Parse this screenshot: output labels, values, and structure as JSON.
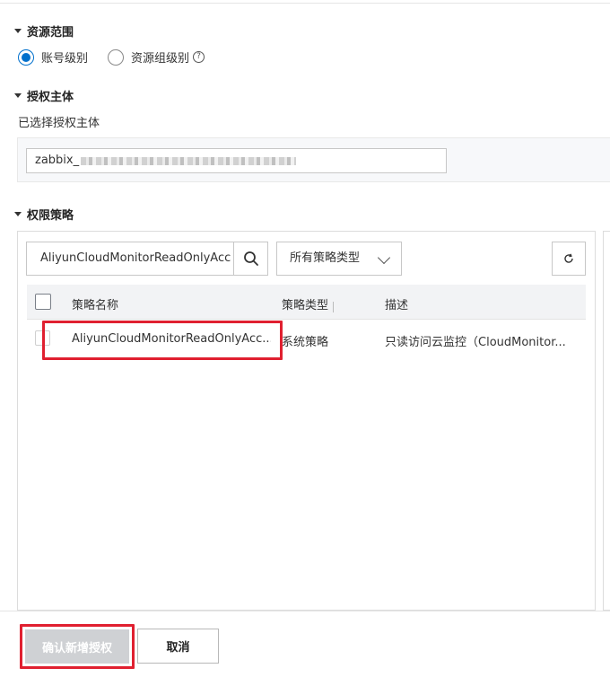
{
  "resource_scope": {
    "title": "资源范围",
    "options": [
      {
        "label": "账号级别",
        "checked": true
      },
      {
        "label": "资源组级别",
        "checked": false
      }
    ],
    "help_icon": "question-circle-icon"
  },
  "principal": {
    "title": "授权主体",
    "selected_label": "已选择授权主体",
    "value": "zabbix_"
  },
  "policy": {
    "title": "权限策略",
    "search_value": "AliyunCloudMonitorReadOnlyAcc",
    "type_select": "所有策略类型",
    "columns": [
      "策略名称",
      "策略类型",
      "描述"
    ],
    "rows": [
      {
        "name": "AliyunCloudMonitorReadOnlyAcc...",
        "type": "系统策略",
        "description": "只读访问云监控（CloudMonitor..."
      }
    ]
  },
  "footer": {
    "confirm_label": "确认新增授权",
    "cancel_label": "取消"
  },
  "colors": {
    "accent": "#0070cc",
    "highlight": "#e02030",
    "disabled_button": "#cfd1d4"
  }
}
